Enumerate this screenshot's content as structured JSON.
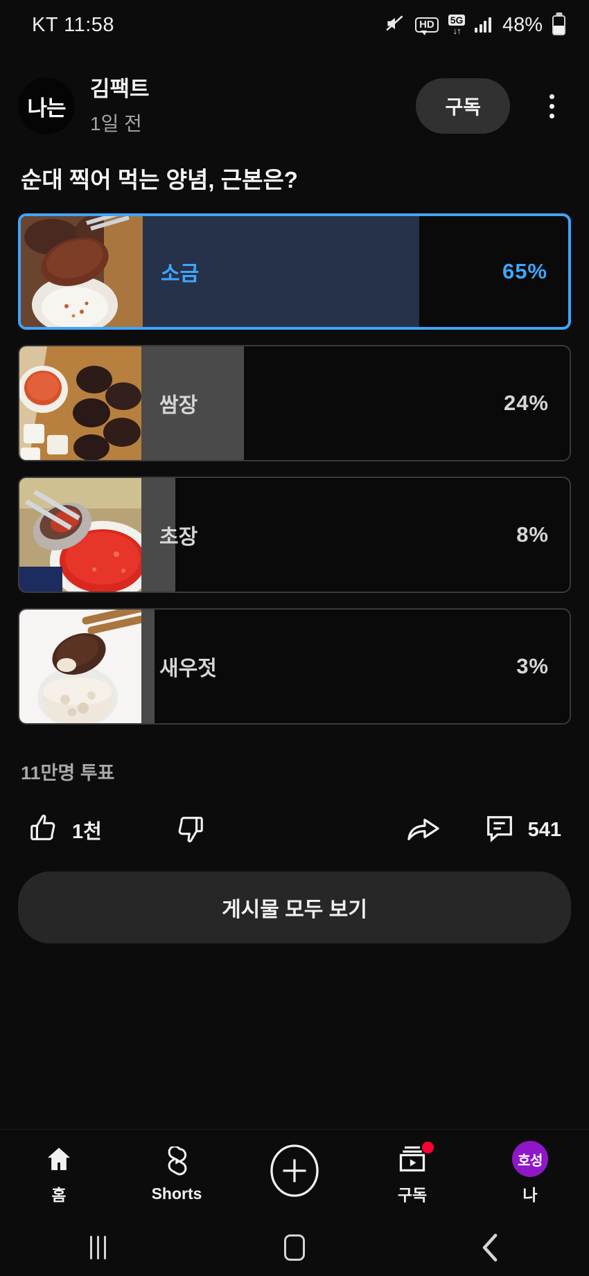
{
  "statusbar": {
    "carrier_time": "KT 11:58",
    "battery_percent": "48%",
    "icons": [
      "mute-icon",
      "hd-icon",
      "5g-icon",
      "signal-icon",
      "battery-icon"
    ],
    "hd_label": "HD",
    "fiveg_label": "5G",
    "fiveg_arrows": "↓↑"
  },
  "channel": {
    "avatar_text": "나는",
    "name": "김팩트",
    "time": "1일 전",
    "subscribe_label": "구독",
    "menu_icon": "kebab-menu-icon"
  },
  "poll": {
    "question": "순대 찍어 먹는 양념, 근본은?",
    "votes_text": "11만명 투표",
    "selected_color": "#3ea6ff",
    "options": [
      {
        "label": "소금",
        "percent_text": "65%",
        "percent": 65,
        "selected": true,
        "thumb": "salt-dip-photo"
      },
      {
        "label": "쌈장",
        "percent_text": "24%",
        "percent": 24,
        "selected": false,
        "thumb": "ssamjang-board-photo"
      },
      {
        "label": "초장",
        "percent_text": "8%",
        "percent": 8,
        "selected": false,
        "thumb": "chojang-spoon-photo"
      },
      {
        "label": "새우젓",
        "percent_text": "3%",
        "percent": 3,
        "selected": false,
        "thumb": "saeujeot-bowl-photo"
      }
    ]
  },
  "actions": {
    "like_icon": "thumbs-up-icon",
    "like_count": "1천",
    "dislike_icon": "thumbs-down-icon",
    "dislike_count": "",
    "share_icon": "share-icon",
    "comment_icon": "comment-icon",
    "comment_count": "541"
  },
  "see_all": {
    "label": "게시물 모두 보기"
  },
  "bottom_nav": [
    {
      "label": "홈",
      "icon": "home-icon",
      "badge": false
    },
    {
      "label": "Shorts",
      "icon": "shorts-icon",
      "badge": false
    },
    {
      "label": "",
      "icon": "create-plus-icon",
      "badge": false
    },
    {
      "label": "구독",
      "icon": "subscriptions-icon",
      "badge": true
    },
    {
      "label": "나",
      "icon": "account-avatar",
      "badge": false,
      "avatar_text": "호성"
    }
  ],
  "system_nav": {
    "recents_icon": "recents-icon",
    "home_icon": "home-square-icon",
    "back_icon": "back-chevron-icon",
    "back_glyph": "❮"
  }
}
